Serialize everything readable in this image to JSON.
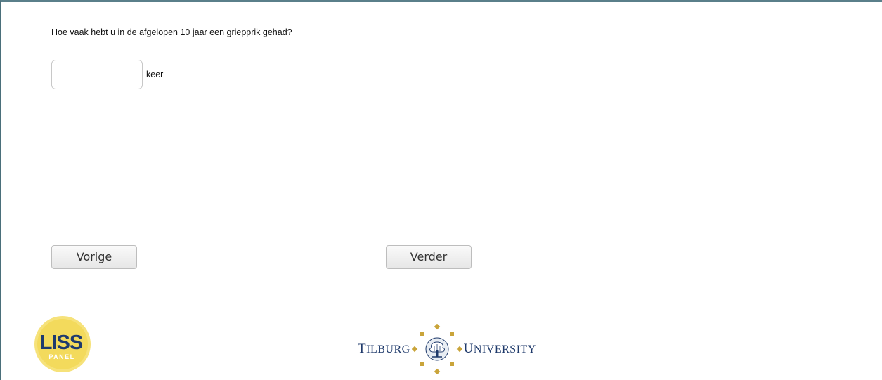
{
  "question": {
    "text": "Hoe vaak hebt u in de afgelopen 10 jaar een griepprik gehad?"
  },
  "answer": {
    "value": "",
    "placeholder": "",
    "unit": "keer"
  },
  "navigation": {
    "previous_label": "Vorige",
    "next_label": "Verder"
  },
  "footer": {
    "liss_logo": {
      "top_text": "LISS",
      "bottom_text": "PANEL",
      "color": "#f6e27a",
      "text_color": "#1e3a6e"
    },
    "university_logo": {
      "left_text": "Tilburg",
      "right_text": "University",
      "emblem": "tree-emblem-icon",
      "accent_color": "#c9a43a",
      "text_color": "#1f3a6b"
    }
  }
}
